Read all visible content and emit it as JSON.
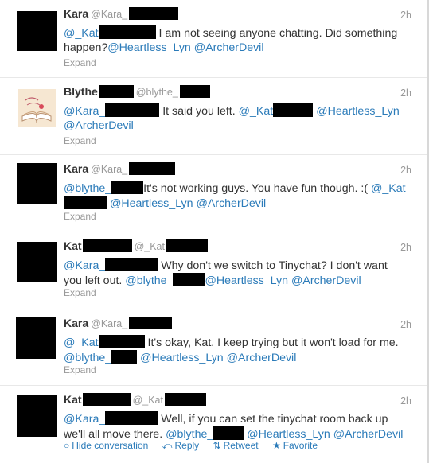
{
  "colors": {
    "link": "#2b7bb9",
    "meta": "#999999",
    "text": "#333333"
  },
  "tweets": [
    {
      "name": "Kara",
      "handle": "@Kara_",
      "time": "2h",
      "parts": [
        {
          "t": "@_Kat",
          "link": true
        },
        {
          "t": "R1"
        },
        {
          "t": " I am not seeing anyone chatting. Did something happen?"
        },
        {
          "t": "@Heartless_Lyn",
          "link": true
        },
        {
          "t": " "
        },
        {
          "t": "@ArcherDevil",
          "link": true
        }
      ],
      "expand": "Expand"
    },
    {
      "name": "Blythe",
      "handle": "@blythe_",
      "time": "2h",
      "parts": [
        {
          "t": "@Kara_",
          "link": true
        },
        {
          "t": "R2"
        },
        {
          "t": " It said you left. "
        },
        {
          "t": "@_Kat",
          "link": true
        },
        {
          "t": "R3"
        },
        {
          "t": " "
        },
        {
          "t": "@Heartless_Lyn",
          "link": true
        },
        {
          "t": " "
        },
        {
          "t": "@ArcherDevil",
          "link": true
        }
      ],
      "expand": "Expand"
    },
    {
      "name": "Kara",
      "handle": "@Kara_",
      "time": "2h",
      "parts": [
        {
          "t": "@blythe_",
          "link": true
        },
        {
          "t": "R4"
        },
        {
          "t": "It's not working guys. You have fun though. :( "
        },
        {
          "t": "@_Kat",
          "link": true
        },
        {
          "t": "R5"
        },
        {
          "t": " "
        },
        {
          "t": "@Heartless_Lyn",
          "link": true
        },
        {
          "t": " "
        },
        {
          "t": "@ArcherDevil",
          "link": true
        }
      ],
      "expand": "Expand"
    },
    {
      "name": "Kat",
      "handle": "@_Kat",
      "time": "2h",
      "parts": [
        {
          "t": "@Kara_",
          "link": true
        },
        {
          "t": "R6"
        },
        {
          "t": " Why don't we switch to Tinychat? I don't want you left out. "
        },
        {
          "t": "@blythe_",
          "link": true
        },
        {
          "t": "R7"
        },
        {
          "t": "@Heartless_Lyn",
          "link": true
        },
        {
          "t": " "
        },
        {
          "t": "@ArcherDevil",
          "link": true
        }
      ],
      "expand": "Expand"
    },
    {
      "name": "Kara",
      "handle": "@Kara_",
      "time": "2h",
      "parts": [
        {
          "t": "@_Kat",
          "link": true
        },
        {
          "t": "R8"
        },
        {
          "t": " It's okay, Kat. I keep trying but it won't load for me. "
        },
        {
          "t": "@blythe_",
          "link": true
        },
        {
          "t": "R9"
        },
        {
          "t": " "
        },
        {
          "t": "@Heartless_Lyn",
          "link": true
        },
        {
          "t": " "
        },
        {
          "t": "@ArcherDevil",
          "link": true
        }
      ],
      "expand": "Expand"
    },
    {
      "name": "Kat",
      "handle": "@_Kat",
      "time": "2h",
      "parts": [
        {
          "t": "@Kara_",
          "link": true
        },
        {
          "t": "R10"
        },
        {
          "t": " Well, if you can set the tinychat room back up we'll all move there. "
        },
        {
          "t": "@blythe_",
          "link": true
        },
        {
          "t": "R11"
        },
        {
          "t": " "
        },
        {
          "t": "@Heartless_Lyn",
          "link": true
        },
        {
          "t": " "
        },
        {
          "t": "@ArcherDevil",
          "link": true
        }
      ],
      "actions": {
        "hide": "Hide conversation",
        "reply": "Reply",
        "retweet": "Retweet",
        "favorite": "Favorite"
      }
    }
  ]
}
